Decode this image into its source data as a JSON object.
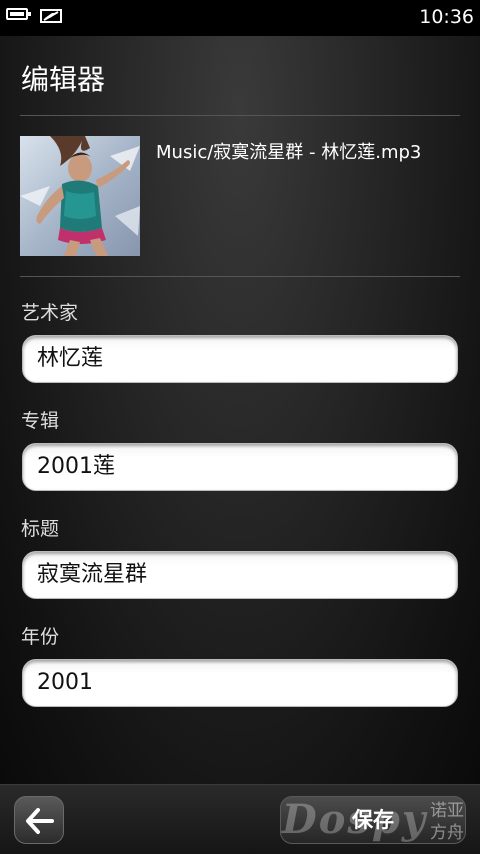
{
  "status_bar": {
    "time": "10:36",
    "icons": [
      "battery-icon",
      "no-signal-icon"
    ]
  },
  "header": {
    "title": "编辑器"
  },
  "file": {
    "name": "Music/寂寞流星群 - 林忆莲.mp3"
  },
  "fields": [
    {
      "label": "艺术家",
      "value": "林忆莲"
    },
    {
      "label": "专辑",
      "value": "2001莲"
    },
    {
      "label": "标题",
      "value": "寂寞流星群"
    },
    {
      "label": "年份",
      "value": "2001"
    }
  ],
  "toolbar": {
    "save_label": "保存",
    "back_icon": "back-arrow-icon"
  },
  "watermark": {
    "text": "Dospy",
    "cn_line1": "诺亚",
    "cn_line2": "方舟"
  },
  "colors": {
    "background": "#1e1e1e",
    "input_bg": "#ffffff",
    "text": "#ffffff"
  }
}
